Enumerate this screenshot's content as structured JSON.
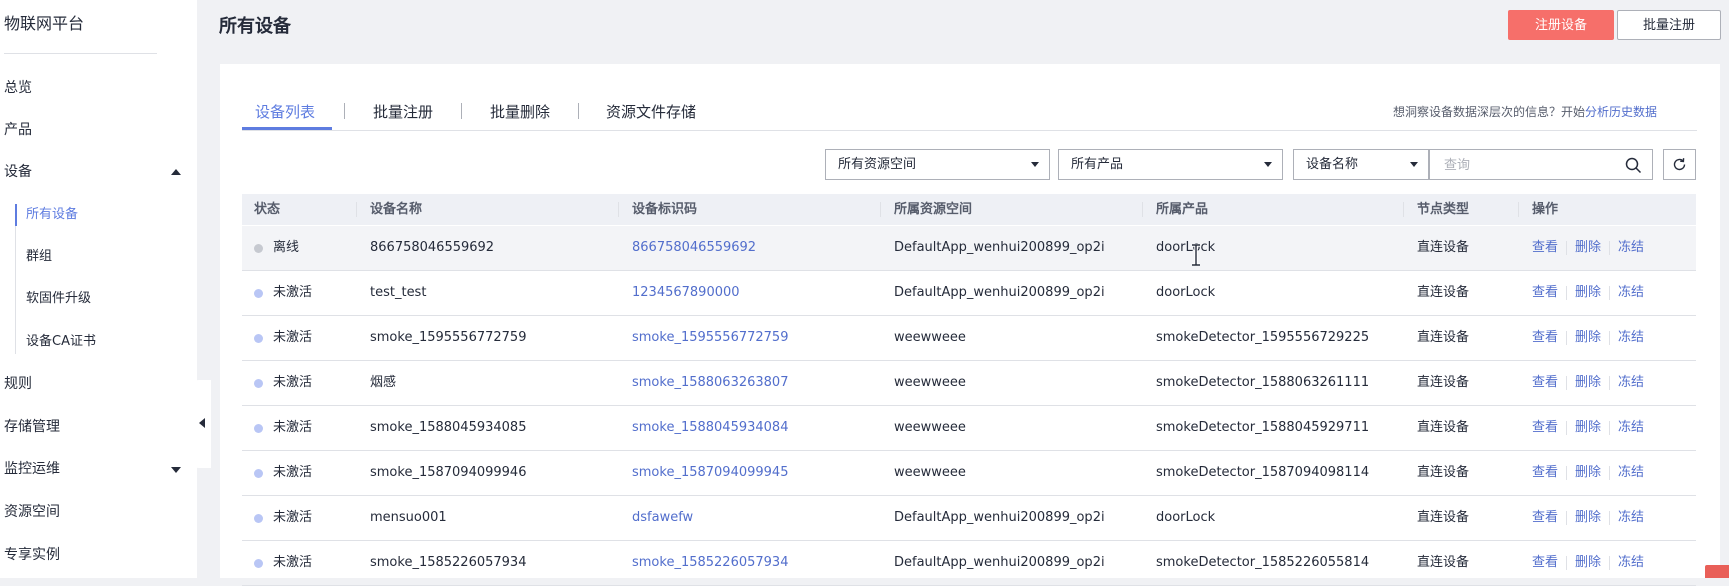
{
  "sidebar": {
    "brand": "物联网平台",
    "items": [
      {
        "label": "总览"
      },
      {
        "label": "产品"
      },
      {
        "label": "设备"
      },
      {
        "label": "所有设备"
      },
      {
        "label": "群组"
      },
      {
        "label": "软固件升级"
      },
      {
        "label": "设备CA证书"
      },
      {
        "label": "规则"
      },
      {
        "label": "存储管理"
      },
      {
        "label": "监控运维"
      },
      {
        "label": "资源空间"
      },
      {
        "label": "专享实例"
      }
    ]
  },
  "header": {
    "title": "所有设备",
    "register_label": "注册设备",
    "batch_register_label": "批量注册"
  },
  "tabs": [
    {
      "label": "设备列表"
    },
    {
      "label": "批量注册"
    },
    {
      "label": "批量删除"
    },
    {
      "label": "资源文件存储"
    }
  ],
  "hint": {
    "text": "想洞察设备数据深层次的信息？开始",
    "link": "分析历史数据"
  },
  "filters": {
    "space": "所有资源空间",
    "product": "所有产品",
    "field": "设备名称",
    "search_placeholder": "查询"
  },
  "table": {
    "columns": [
      "状态",
      "设备名称",
      "设备标识码",
      "所属资源空间",
      "所属产品",
      "节点类型",
      "操作"
    ],
    "ops": [
      "查看",
      "删除",
      "冻结"
    ],
    "rows": [
      {
        "status": "离线",
        "status_type": "offline",
        "name": "866758046559692",
        "id": "866758046559692",
        "space": "DefaultApp_wenhui200899_op2i",
        "product": "doorLock",
        "node": "直连设备"
      },
      {
        "status": "未激活",
        "status_type": "inactive",
        "name": "test_test",
        "id": "1234567890000",
        "space": "DefaultApp_wenhui200899_op2i",
        "product": "doorLock",
        "node": "直连设备"
      },
      {
        "status": "未激活",
        "status_type": "inactive",
        "name": "smoke_1595556772759",
        "id": "smoke_1595556772759",
        "space": "weewweee",
        "product": "smokeDetector_1595556729225",
        "node": "直连设备"
      },
      {
        "status": "未激活",
        "status_type": "inactive",
        "name": "烟感",
        "id": "smoke_1588063263807",
        "space": "weewweee",
        "product": "smokeDetector_1588063261111",
        "node": "直连设备"
      },
      {
        "status": "未激活",
        "status_type": "inactive",
        "name": "smoke_1588045934085",
        "id": "smoke_1588045934084",
        "space": "weewweee",
        "product": "smokeDetector_1588045929711",
        "node": "直连设备"
      },
      {
        "status": "未激活",
        "status_type": "inactive",
        "name": "smoke_1587094099946",
        "id": "smoke_1587094099945",
        "space": "weewweee",
        "product": "smokeDetector_1587094098114",
        "node": "直连设备"
      },
      {
        "status": "未激活",
        "status_type": "inactive",
        "name": "mensuo001",
        "id": "dsfawefw",
        "space": "DefaultApp_wenhui200899_op2i",
        "product": "doorLock",
        "node": "直连设备"
      },
      {
        "status": "未激活",
        "status_type": "inactive",
        "name": "smoke_1585226057934",
        "id": "smoke_1585226057934",
        "space": "DefaultApp_wenhui200899_op2i",
        "product": "smokeDetector_1585226055814",
        "node": "直连设备"
      }
    ]
  },
  "colors": {
    "accent": "#5e7ce0",
    "primary_button": "#f66f6a",
    "link": "#526ecc"
  }
}
